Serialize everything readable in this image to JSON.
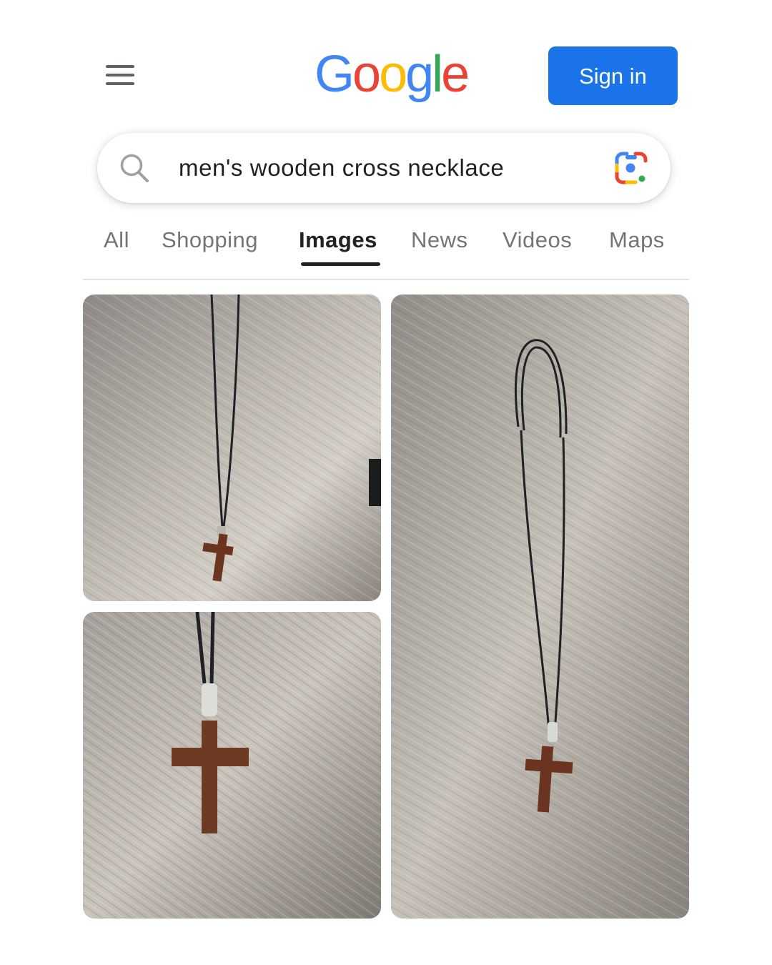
{
  "header": {
    "menu_icon": "hamburger-menu-icon",
    "logo": {
      "letters": [
        "G",
        "o",
        "o",
        "g",
        "l",
        "e"
      ],
      "colors": [
        "#4285F4",
        "#EA4335",
        "#FBBC05",
        "#4285F4",
        "#34A853",
        "#EA4335"
      ]
    },
    "signin_label": "Sign in",
    "signin_color": "#1a73e8"
  },
  "search": {
    "query": "men's wooden cross necklace",
    "search_icon": "magnifier-icon",
    "lens_icon": "google-lens-camera-icon"
  },
  "tabs": [
    {
      "label": "All",
      "active": false
    },
    {
      "label": "Shopping",
      "active": false
    },
    {
      "label": "Images",
      "active": true
    },
    {
      "label": "News",
      "active": false
    },
    {
      "label": "Videos",
      "active": false
    },
    {
      "label": "Maps",
      "active": false
    }
  ],
  "results": [
    {
      "subject": "wooden cross necklace on black cord, close view on grey wood surface"
    },
    {
      "subject": "wooden cross pendant close-up on grey wood surface"
    },
    {
      "subject": "full wooden cross necklace with black cord loop on grey wood surface"
    }
  ]
}
